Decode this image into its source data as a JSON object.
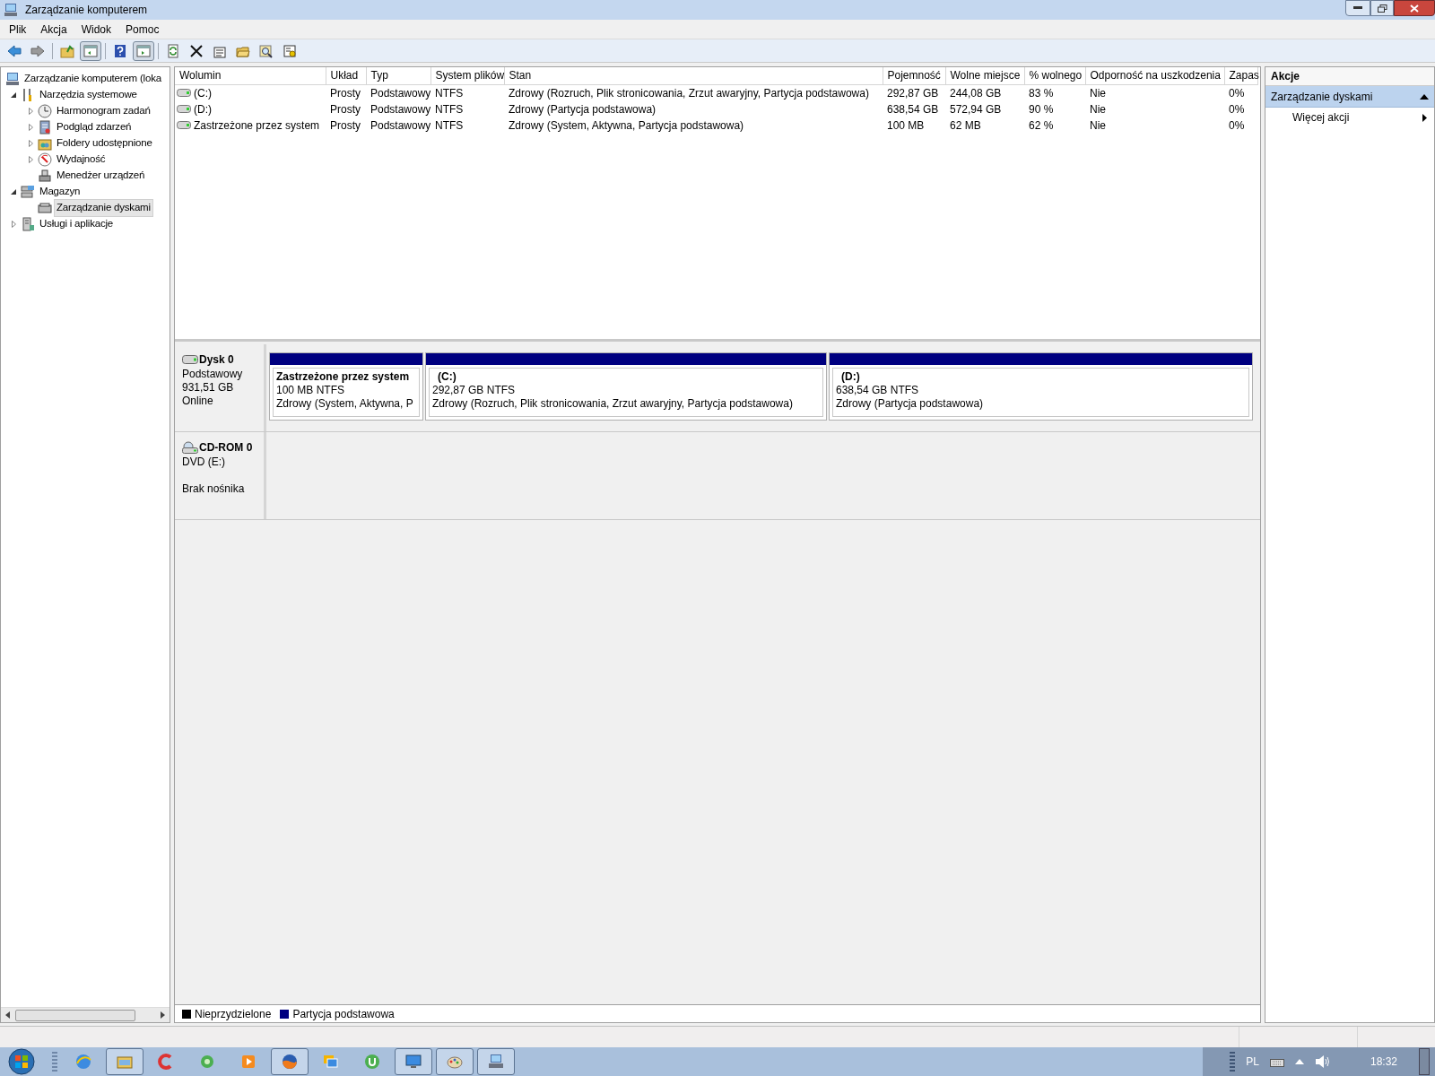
{
  "window": {
    "title": "Zarządzanie komputerem"
  },
  "menu": [
    "Plik",
    "Akcja",
    "Widok",
    "Pomoc"
  ],
  "toolbar": [
    {
      "pressed": false
    },
    {
      "pressed": false
    },
    {
      "pressed": false
    },
    {
      "pressed": true
    },
    {
      "pressed": false
    },
    {
      "pressed": true
    },
    {
      "pressed": false
    },
    {
      "pressed": false
    },
    {
      "pressed": false
    },
    {
      "pressed": false
    },
    {
      "pressed": false
    },
    {
      "pressed": false
    }
  ],
  "tree": [
    {
      "label": "Zarządzanie komputerem (loka",
      "selected": false,
      "children": [
        {
          "label": "Narzędzia systemowe",
          "expanded": true,
          "selected": false,
          "children": [
            {
              "label": "Harmonogram zadań",
              "expanded": false,
              "selected": false
            },
            {
              "label": "Podgląd zdarzeń",
              "expanded": false,
              "selected": false
            },
            {
              "label": "Foldery udostępnione",
              "expanded": false,
              "selected": false
            },
            {
              "label": "Wydajność",
              "expanded": false,
              "selected": false
            },
            {
              "label": "Menedżer urządzeń",
              "selected": false
            }
          ]
        },
        {
          "label": "Magazyn",
          "expanded": true,
          "selected": false,
          "children": [
            {
              "label": "Zarządzanie dyskami",
              "selected": true
            }
          ]
        },
        {
          "label": "Usługi i aplikacje",
          "expanded": false,
          "selected": false
        }
      ]
    }
  ],
  "table": {
    "columns": [
      "Wolumin",
      "Układ",
      "Typ",
      "System plików",
      "Stan",
      "Pojemność",
      "Wolne miejsce",
      "% wolnego",
      "Odporność na uszkodzenia",
      "Zapas"
    ],
    "rows": [
      [
        "(C:)",
        "Prosty",
        "Podstawowy",
        "NTFS",
        "Zdrowy (Rozruch, Plik stronicowania, Zrzut awaryjny, Partycja podstawowa)",
        "292,87 GB",
        "244,08 GB",
        "83 %",
        "Nie",
        "0%"
      ],
      [
        "(D:)",
        "Prosty",
        "Podstawowy",
        "NTFS",
        "Zdrowy (Partycja podstawowa)",
        "638,54 GB",
        "572,94 GB",
        "90 %",
        "Nie",
        "0%"
      ],
      [
        "Zastrzeżone przez system",
        "Prosty",
        "Podstawowy",
        "NTFS",
        "Zdrowy (System, Aktywna, Partycja podstawowa)",
        "100 MB",
        "62 MB",
        "62 %",
        "Nie",
        "0%"
      ]
    ]
  },
  "disks": [
    {
      "kind": "disk",
      "name": "Dysk 0",
      "lines": [
        "Podstawowy",
        "931,51 GB",
        "Online"
      ],
      "partitions": [
        {
          "label": "Zastrzeżone przez system",
          "size": "100 MB NTFS",
          "status": "Zdrowy (System, Aktywna, P",
          "color": "#000080"
        },
        {
          "label": "(C:)",
          "size": "292,87 GB NTFS",
          "status": "Zdrowy (Rozruch, Plik stronicowania, Zrzut awaryjny, Partycja podstawowa)",
          "color": "#000080"
        },
        {
          "label": "(D:)",
          "size": "638,54 GB NTFS",
          "status": "Zdrowy (Partycja podstawowa)",
          "color": "#000080"
        }
      ]
    },
    {
      "kind": "cdrom",
      "name": "CD-ROM 0",
      "lines": [
        "DVD (E:)"
      ],
      "status": "Brak nośnika"
    }
  ],
  "legend": [
    {
      "label": "Nieprzydzielone",
      "color": "#000000"
    },
    {
      "label": "Partycja podstawowa",
      "color": "#000080"
    }
  ],
  "actions": {
    "title": "Akcje",
    "section": {
      "label": "Zarządzanie dyskami",
      "expanded": true
    },
    "items": [
      "Więcej akcji"
    ]
  },
  "taskbar": {
    "apps": [
      {
        "open": false
      },
      {
        "open": true
      },
      {
        "open": false
      },
      {
        "open": false
      },
      {
        "open": false
      },
      {
        "open": true
      },
      {
        "open": false
      },
      {
        "open": false
      },
      {
        "open": true
      },
      {
        "open": true
      },
      {
        "open": true
      }
    ],
    "language": "PL",
    "clock": "18:32"
  }
}
